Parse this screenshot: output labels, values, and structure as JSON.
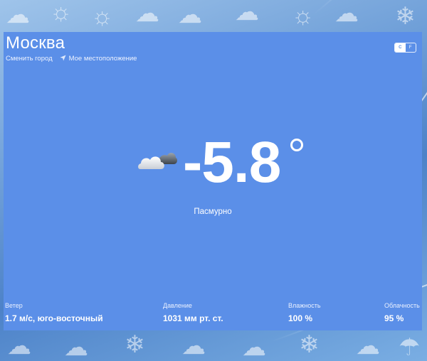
{
  "city": {
    "name": "Москва",
    "change_city_label": "Сменить город",
    "my_location_label": "Мое местоположение"
  },
  "units": {
    "celsius_label": "C",
    "fahrenheit_label": "F",
    "selected": "C"
  },
  "current": {
    "icon": "overcast-cloud-icon",
    "temperature": "-5.8",
    "condition": "Пасмурно"
  },
  "stats": [
    {
      "label": "Ветер",
      "value": "1.7 м/с, юго-восточный"
    },
    {
      "label": "Давление",
      "value": "1031 мм рт. ст."
    },
    {
      "label": "Влажность",
      "value": "100 %"
    },
    {
      "label": "Облачность",
      "value": "95 %"
    }
  ],
  "colors": {
    "panel": "#5b8fe8",
    "text": "#ffffff"
  }
}
